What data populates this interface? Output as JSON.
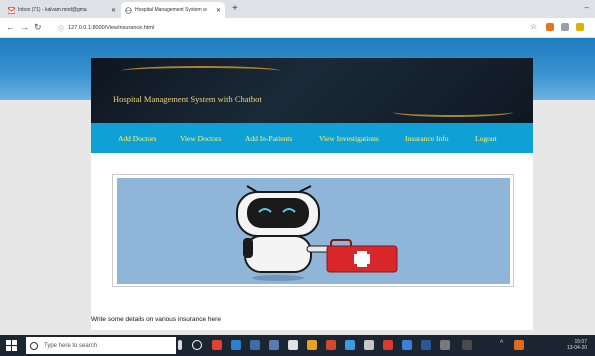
{
  "browser": {
    "tabs": [
      {
        "label": "Inbox (71) - kalvam.mnd@gma",
        "active": false
      },
      {
        "label": "Hospital Management System w",
        "active": true
      }
    ],
    "url": "127.0.0.1:8000/ViewInsurance.html"
  },
  "site": {
    "title": "Hospital Management System with Chatbot",
    "menu": [
      {
        "label": "Add Doctors"
      },
      {
        "label": "View Doctors"
      },
      {
        "label": "Add In-Patients"
      },
      {
        "label": "View Investigations"
      },
      {
        "label": "Insurance Info"
      },
      {
        "label": "Logout"
      }
    ],
    "caption": "Write some details on various insurance here"
  },
  "taskbar": {
    "search_placeholder": "Type here to search",
    "time": "15:07",
    "date": "13-04-20"
  },
  "colors": {
    "menu_bg": "#0fa1d6",
    "menu_text": "#fff36b",
    "banner_text": "#f2d27a",
    "image_bg": "#8fb6d8"
  }
}
